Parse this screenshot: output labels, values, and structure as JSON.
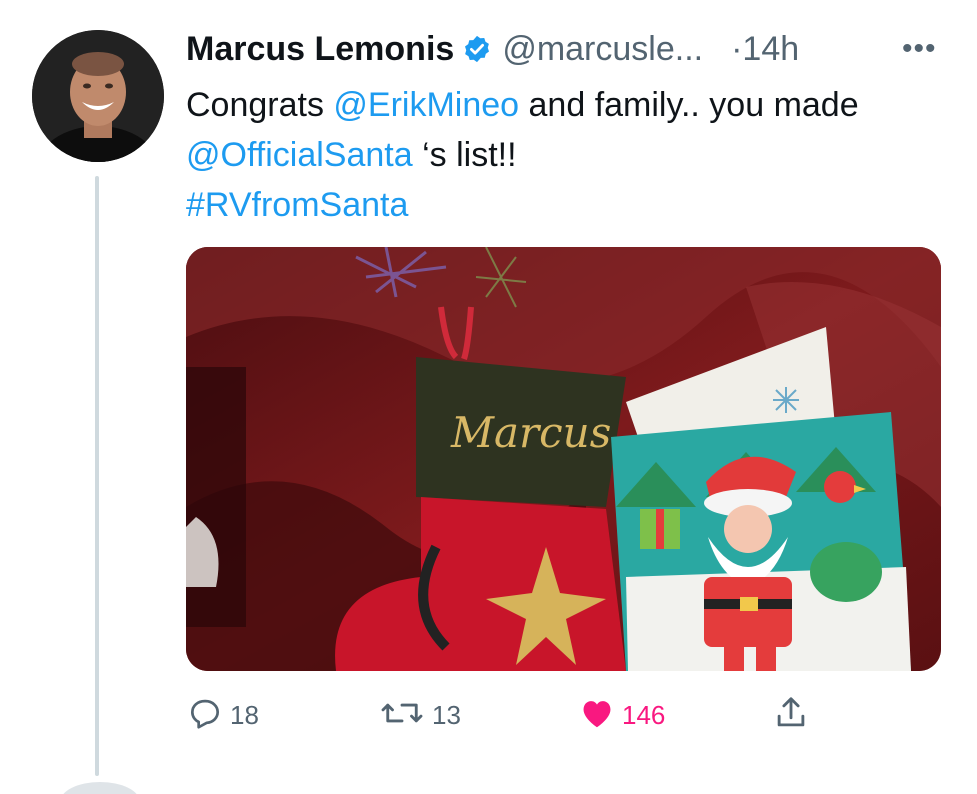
{
  "tweet": {
    "author_name": "Marcus Lemonis",
    "handle": "@marcusle...",
    "separator": "·",
    "time": "14h",
    "more_label": "•••",
    "text_segments": [
      {
        "text": "Congrats ",
        "type": "plain"
      },
      {
        "text": "@ErikMineo",
        "type": "mention"
      },
      {
        "text": " and family.. you made ",
        "type": "plain"
      },
      {
        "text": "@OfficialSanta",
        "type": "mention"
      },
      {
        "text": " ‘s list!! ",
        "type": "plain"
      },
      {
        "text": "#RVfromSanta",
        "type": "hashtag"
      }
    ],
    "media": {
      "stocking_name": "Marcus",
      "description_icons": [
        "stocking",
        "santa-card",
        "snowflake"
      ]
    },
    "actions": {
      "reply_count": "18",
      "retweet_count": "13",
      "like_count": "146",
      "liked": true
    }
  },
  "colors": {
    "link": "#1d9bf0",
    "like": "#f91880",
    "secondary_text": "#536471",
    "verified": "#1d9bf0"
  }
}
